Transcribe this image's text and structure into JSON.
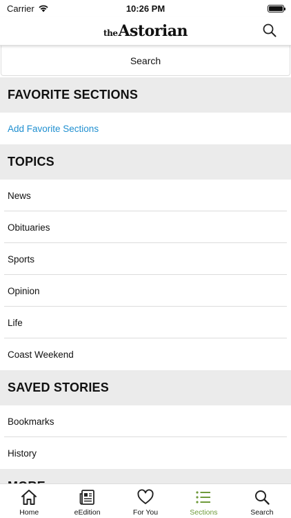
{
  "status_bar": {
    "carrier": "Carrier",
    "time": "10:26 PM",
    "battery_level": 1.0
  },
  "header": {
    "logo_prefix": "the",
    "logo_main": "Astorian",
    "search_icon": "search-icon"
  },
  "search": {
    "label": "Search"
  },
  "favorite_sections": {
    "title": "FAVORITE SECTIONS",
    "add_link": "Add Favorite Sections"
  },
  "topics": {
    "title": "TOPICS",
    "items": [
      "News",
      "Obituaries",
      "Sports",
      "Opinion",
      "Life",
      "Coast Weekend"
    ]
  },
  "saved_stories": {
    "title": "SAVED STORIES",
    "items": [
      "Bookmarks",
      "History"
    ]
  },
  "more": {
    "title": "MORE"
  },
  "tab_bar": {
    "active_color": "#6e9a3a",
    "tabs": [
      {
        "label": "Home",
        "icon": "home-icon"
      },
      {
        "label": "eEdition",
        "icon": "newspaper-icon"
      },
      {
        "label": "For You",
        "icon": "heart-icon"
      },
      {
        "label": "Sections",
        "icon": "list-icon"
      },
      {
        "label": "Search",
        "icon": "search-icon"
      }
    ],
    "active_index": 3
  },
  "colors": {
    "link": "#1f8fd0",
    "section_bg": "#ebebeb"
  }
}
